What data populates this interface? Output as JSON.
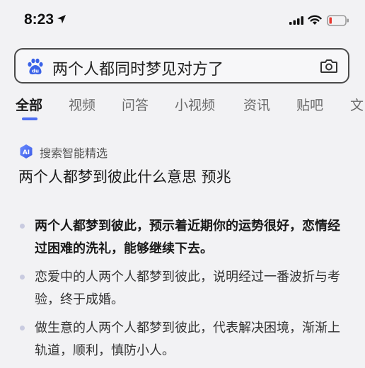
{
  "status_bar": {
    "time": "8:23",
    "battery_color": "#e8382f"
  },
  "search": {
    "query": "两个人都同时梦见对方了",
    "icon_left": "baidu-paw-icon",
    "icon_right": "camera-icon"
  },
  "tabs": [
    {
      "label": "全部",
      "active": true
    },
    {
      "label": "视频",
      "active": false
    },
    {
      "label": "问答",
      "active": false
    },
    {
      "label": "小视频",
      "active": false
    },
    {
      "label": "资讯",
      "active": false
    },
    {
      "label": "贴吧",
      "active": false
    },
    {
      "label": "文",
      "active": false
    }
  ],
  "ai_result": {
    "source_badge": "AI",
    "source_label": "搜索智能精选",
    "title": "两个人都梦到彼此什么意思 预兆",
    "bullets": [
      {
        "text": "两个人都梦到彼此，预示着近期你的运势很好，恋情经过困难的洗礼，能够继续下去。",
        "bold": true
      },
      {
        "text": "恋爱中的人两个人都梦到彼此，说明经过一番波折与考验，终于成婚。",
        "bold": false
      },
      {
        "text": "做生意的人两个人都梦到彼此，代表解决困境，渐渐上轨道，顺利，慎防小人。",
        "bold": false
      }
    ]
  },
  "colors": {
    "accent": "#4e6ef2",
    "background": "#f2f2f4"
  }
}
